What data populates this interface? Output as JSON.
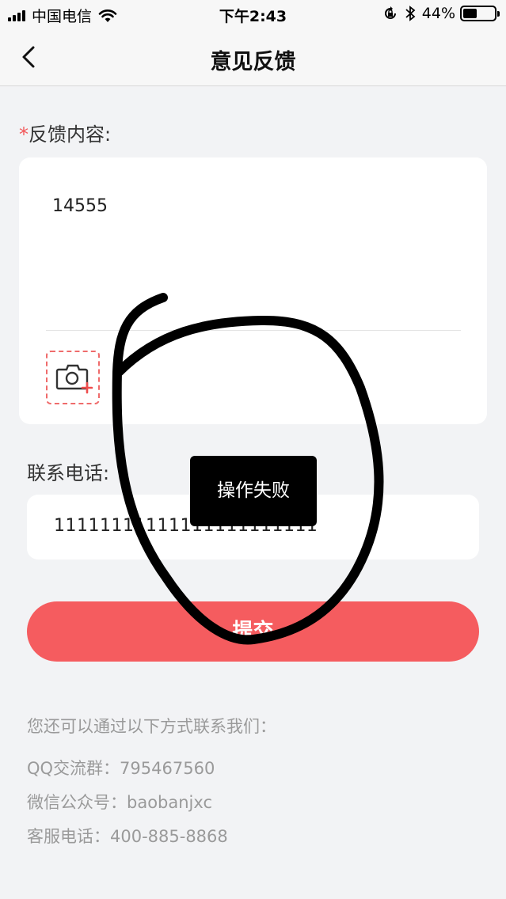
{
  "status_bar": {
    "carrier": "中国电信",
    "time": "下午2:43",
    "battery": "44%",
    "battery_level": 0.44
  },
  "nav": {
    "title": "意见反馈",
    "back_icon": "chevron-left-icon"
  },
  "form": {
    "required_mark": "*",
    "feedback_label": "反馈内容:",
    "feedback_value": "14555",
    "photo_icon": "camera-add-icon",
    "phone_label": "联系电话:",
    "phone_value": "11111111111111111111111",
    "submit_label": "提交"
  },
  "contact": {
    "intro": "您还可以通过以下方式联系我们：",
    "qq": "QQ交流群：795467560",
    "wechat": "微信公众号：baobanjxc",
    "service": "客服电话：400-885-8868"
  },
  "toast": {
    "message": "操作失败"
  },
  "colors": {
    "accent": "#f55c5f",
    "background": "#f2f3f5",
    "toast_bg": "#000000"
  }
}
